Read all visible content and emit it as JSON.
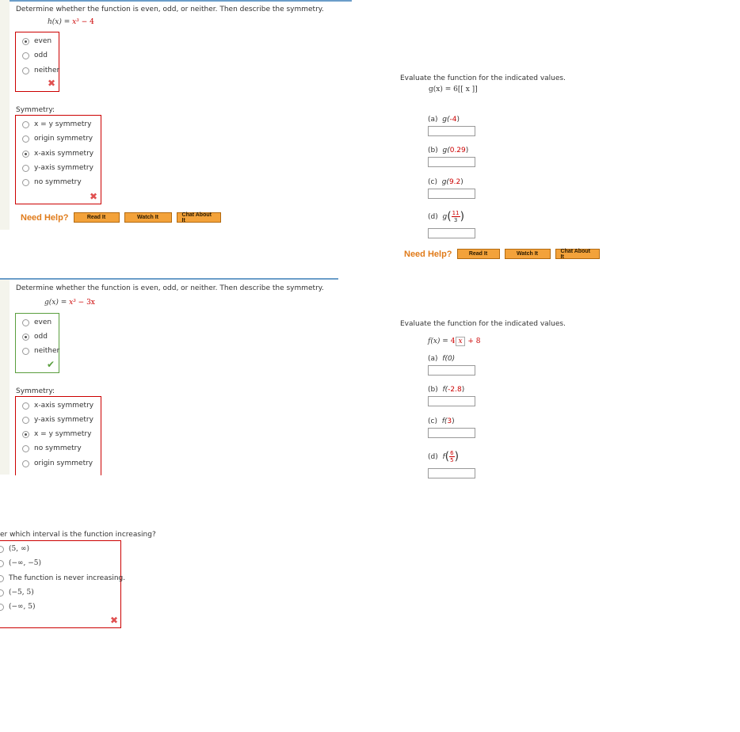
{
  "q1": {
    "prompt": "Determine whether the function is even, odd, or neither. Then describe the symmetry.",
    "func_lhs": "h(x)",
    "func_eq": " = ",
    "func_x3": "x³",
    "func_rest": " − 4",
    "parity_options": [
      "even",
      "odd",
      "neither"
    ],
    "parity_selected": 0,
    "symmetry_label": "Symmetry:",
    "symmetry_options": [
      "x = y symmetry",
      "origin symmetry",
      "x-axis symmetry",
      "y-axis symmetry",
      "no symmetry"
    ],
    "symmetry_selected": 2,
    "help_text": "Need Help?",
    "btn_read": "Read It",
    "btn_watch": "Watch It",
    "btn_chat": "Chat About It"
  },
  "q2": {
    "prompt": "Evaluate the function for the indicated values.",
    "func": "g(x) = 6[[ x ]]",
    "parts": [
      {
        "label": "(a)",
        "expr_pre": "g(",
        "arg": "-4",
        "expr_post": ")"
      },
      {
        "label": "(b)",
        "expr_pre": "g(",
        "arg": "0.29",
        "expr_post": ")"
      },
      {
        "label": "(c)",
        "expr_pre": "g(",
        "arg": "9.2",
        "expr_post": ")"
      },
      {
        "label": "(d)",
        "expr_pre": "g",
        "frac_num": "11",
        "frac_den": "3"
      }
    ],
    "help_text": "Need Help?",
    "btn_read": "Read It",
    "btn_watch": "Watch It",
    "btn_chat": "Chat About It"
  },
  "q3": {
    "prompt": "Determine whether the function is even, odd, or neither. Then describe the symmetry.",
    "func_lhs": "g(x)",
    "func_eq": " = ",
    "func_x3": "x³",
    "func_rest": " − 3x",
    "parity_options": [
      "even",
      "odd",
      "neither"
    ],
    "parity_selected": 1,
    "symmetry_label": "Symmetry:",
    "symmetry_options": [
      "x-axis symmetry",
      "y-axis symmetry",
      "x = y symmetry",
      "no symmetry",
      "origin symmetry"
    ],
    "symmetry_selected": 2
  },
  "q4": {
    "prompt": "Evaluate the function for the indicated values.",
    "func_pre": "f(x) = ",
    "func_coef": "4",
    "func_inner": "x",
    "func_post": " + 8",
    "parts": [
      {
        "label": "(a)",
        "expr": "f(0)"
      },
      {
        "label": "(b)",
        "expr_pre": "f(",
        "arg": "-2.8",
        "expr_post": ")"
      },
      {
        "label": "(c)",
        "expr_pre": "f(",
        "arg": "3",
        "expr_post": ")"
      },
      {
        "label": "(d)",
        "expr_pre": "f",
        "frac_num": "6",
        "frac_den": "5"
      }
    ]
  },
  "q5": {
    "prompt": "er which interval is the function increasing?",
    "options": [
      "(5, ∞)",
      "(−∞, −5)",
      "The function is never increasing.",
      "(−5, 5)",
      "(−∞, 5)"
    ]
  }
}
